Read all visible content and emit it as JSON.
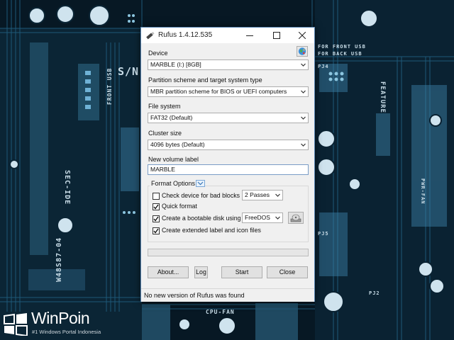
{
  "background": {
    "labels": [
      "S/N:",
      "FRONT USB",
      "SEC-IDE",
      "W48S87-04",
      "FOR FRONT USB",
      "FOR BACK USB",
      "FEATURE",
      "CPU-FAN",
      "PWR-FAN",
      "PJ4",
      "PJ5",
      "PJ2"
    ]
  },
  "window": {
    "title": "Rufus 1.4.12.535",
    "device_label": "Device",
    "device_value": "MARBLE (I:) [8GB]",
    "partition_label": "Partition scheme and target system type",
    "partition_value": "MBR partition scheme for BIOS or UEFI computers",
    "filesystem_label": "File system",
    "filesystem_value": "FAT32 (Default)",
    "cluster_label": "Cluster size",
    "cluster_value": "4096 bytes (Default)",
    "volume_label": "New volume label",
    "volume_value": "MARBLE",
    "format_options": {
      "title": "Format Options",
      "bad_blocks": {
        "label": "Check device for bad blocks",
        "checked": false,
        "passes": "2 Passes"
      },
      "quick_format": {
        "label": "Quick format",
        "checked": true
      },
      "bootable": {
        "label": "Create a bootable disk using",
        "checked": true,
        "type": "FreeDOS"
      },
      "extended_label": {
        "label": "Create extended label and icon files",
        "checked": true
      }
    },
    "progress": 0,
    "buttons": {
      "about": "About...",
      "log": "Log",
      "start": "Start",
      "close": "Close"
    },
    "status": "No new version of Rufus was found"
  },
  "watermark": {
    "brand": "WinPoin",
    "tagline": "#1 Windows Portal Indonesia"
  },
  "colors": {
    "accent": "#5b87b4",
    "pcb": "#0b2535",
    "trace": "#2a6f93"
  }
}
